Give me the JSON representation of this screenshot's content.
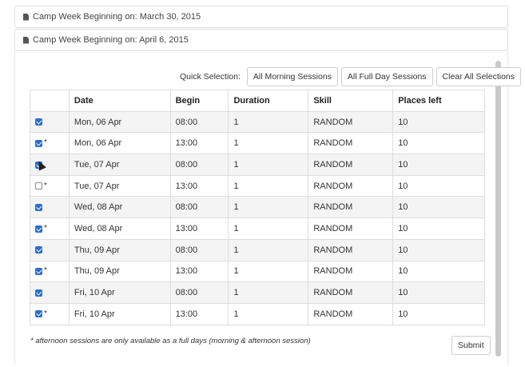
{
  "weeks": [
    {
      "label": "Camp Week Beginning on: March 30, 2015",
      "icon": "document-icon"
    },
    {
      "label": "Camp Week Beginning on: April 6, 2015",
      "icon": "document-icon"
    }
  ],
  "quick_selection": {
    "label": "Quick Selection:",
    "buttons": [
      "All Morning Sessions",
      "All Full Day Sessions",
      "Clear All Selections"
    ]
  },
  "table": {
    "headers": [
      "",
      "Date",
      "Begin",
      "Duration",
      "Skill",
      "Places left"
    ],
    "rows": [
      {
        "checked": true,
        "asterisk": "",
        "date": "Mon, 06 Apr",
        "begin": "08:00",
        "duration": "1",
        "skill": "RANDOM",
        "places": "10"
      },
      {
        "checked": true,
        "asterisk": "*",
        "date": "Mon, 06 Apr",
        "begin": "13:00",
        "duration": "1",
        "skill": "RANDOM",
        "places": "10"
      },
      {
        "checked": true,
        "asterisk": "",
        "date": "Tue, 07 Apr",
        "begin": "08:00",
        "duration": "1",
        "skill": "RANDOM",
        "places": "10"
      },
      {
        "checked": false,
        "asterisk": "*",
        "date": "Tue, 07 Apr",
        "begin": "13:00",
        "duration": "1",
        "skill": "RANDOM",
        "places": "10"
      },
      {
        "checked": true,
        "asterisk": "",
        "date": "Wed, 08 Apr",
        "begin": "08:00",
        "duration": "1",
        "skill": "RANDOM",
        "places": "10"
      },
      {
        "checked": true,
        "asterisk": "*",
        "date": "Wed, 08 Apr",
        "begin": "13:00",
        "duration": "1",
        "skill": "RANDOM",
        "places": "10"
      },
      {
        "checked": true,
        "asterisk": "",
        "date": "Thu, 09 Apr",
        "begin": "08:00",
        "duration": "1",
        "skill": "RANDOM",
        "places": "10"
      },
      {
        "checked": true,
        "asterisk": "*",
        "date": "Thu, 09 Apr",
        "begin": "13:00",
        "duration": "1",
        "skill": "RANDOM",
        "places": "10"
      },
      {
        "checked": true,
        "asterisk": "",
        "date": "Fri, 10 Apr",
        "begin": "08:00",
        "duration": "1",
        "skill": "RANDOM",
        "places": "10"
      },
      {
        "checked": true,
        "asterisk": "*",
        "date": "Fri, 10 Apr",
        "begin": "13:00",
        "duration": "1",
        "skill": "RANDOM",
        "places": "10"
      }
    ]
  },
  "footnote": "* afternoon sessions are only available as a full days (morning & afternoon session)",
  "submit_label": "Submit",
  "colors": {
    "checkbox_checked": "#2d6fc7",
    "stripe": "#f4f4f4",
    "border": "#dddddd"
  }
}
